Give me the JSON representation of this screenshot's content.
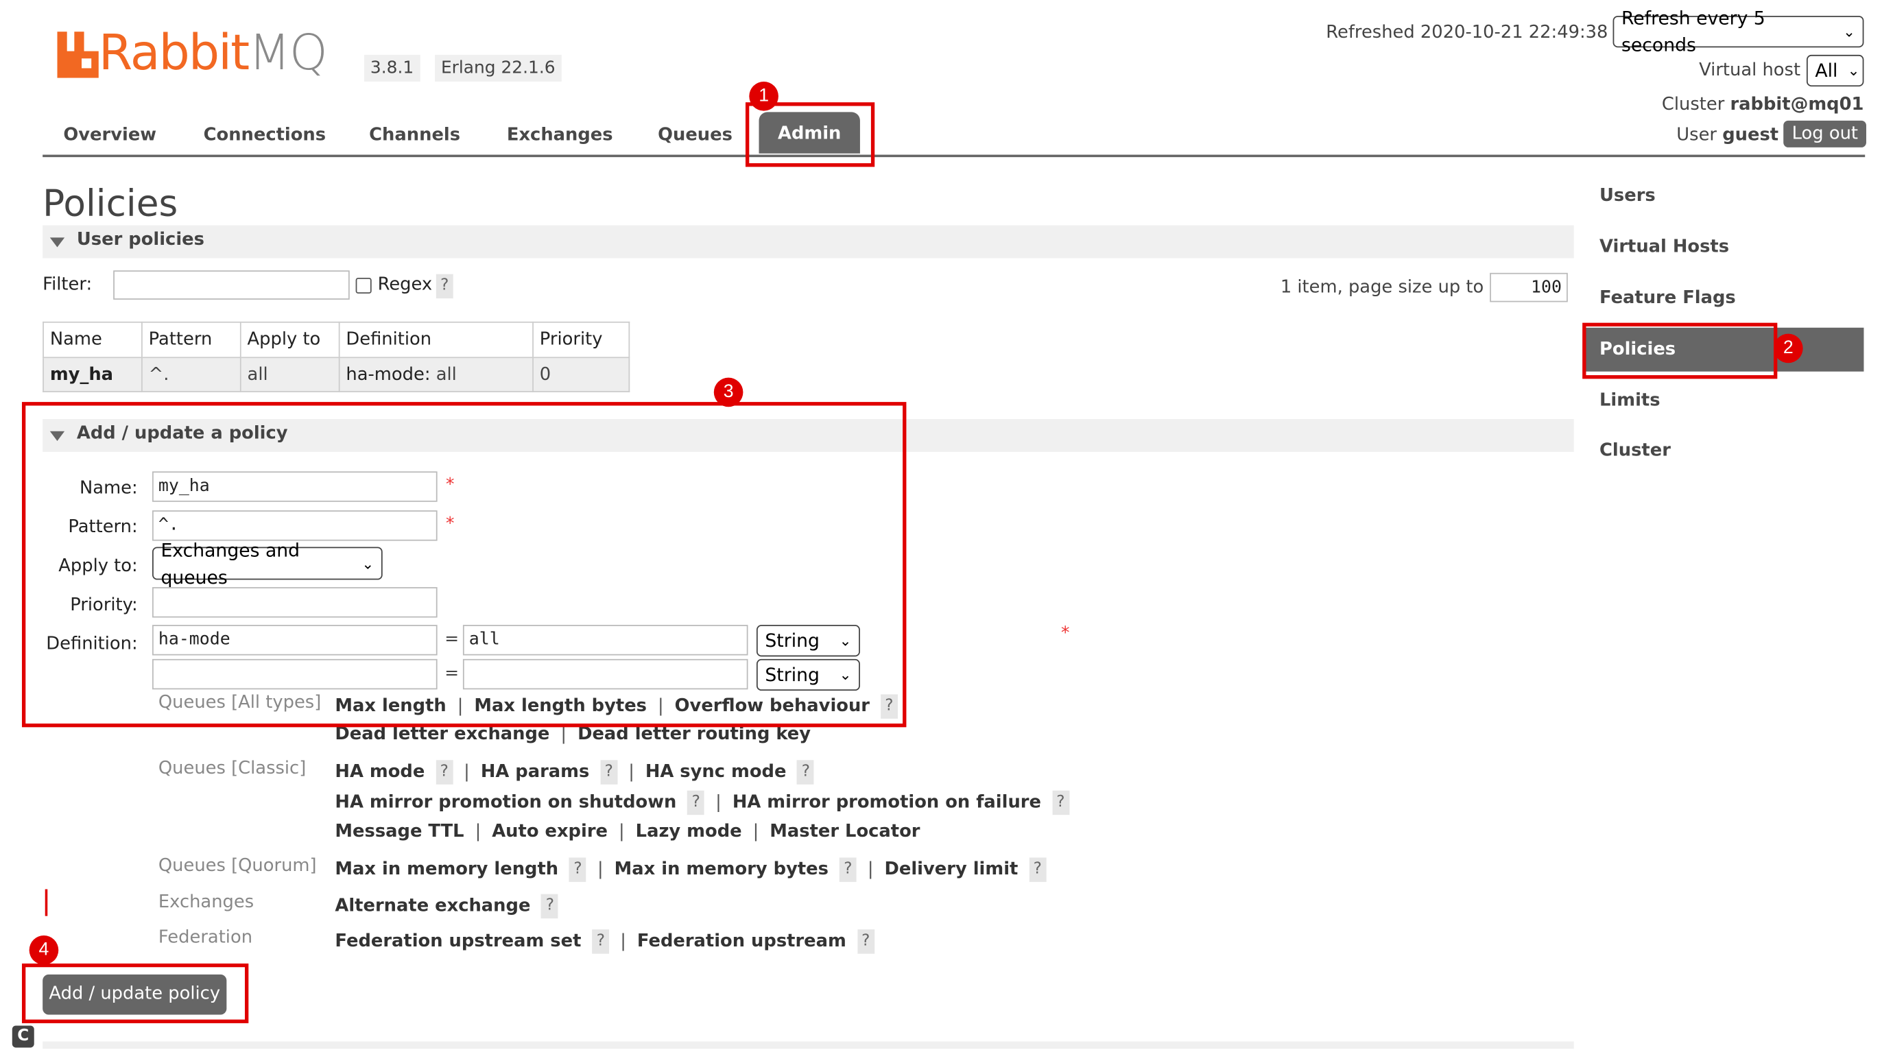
{
  "app": {
    "name_prefix": "Rabbit",
    "name_suffix": "MQ",
    "version": "3.8.1",
    "erlang": "Erlang 22.1.6",
    "brand_color": "#f26822"
  },
  "header": {
    "refreshed": "Refreshed 2020-10-21 22:49:38",
    "refresh_select": "Refresh every 5 seconds",
    "vhost_label": "Virtual host",
    "vhost_value": "All",
    "cluster_label": "Cluster",
    "cluster_value": "rabbit@mq01",
    "user_label": "User",
    "user_value": "guest",
    "logout": "Log out"
  },
  "nav": {
    "tabs": [
      "Overview",
      "Connections",
      "Channels",
      "Exchanges",
      "Queues",
      "Admin"
    ],
    "active": "Admin"
  },
  "sidebar": {
    "items": [
      "Users",
      "Virtual Hosts",
      "Feature Flags",
      "Policies",
      "Limits",
      "Cluster"
    ],
    "active": "Policies"
  },
  "annotations": [
    "1",
    "2",
    "3",
    "4"
  ],
  "page_title": "Policies",
  "user_policies": {
    "title": "User policies",
    "filter_label": "Filter:",
    "filter_value": "",
    "regex_label": "Regex",
    "help": "?",
    "paging_text": "1 item, page size up to",
    "page_size": "100",
    "columns": [
      "Name",
      "Pattern",
      "Apply to",
      "Definition",
      "Priority"
    ],
    "rows": [
      {
        "name": "my_ha",
        "pattern": "^.",
        "apply_to": "all",
        "def_key": "ha-mode:",
        "def_val": "all",
        "priority": "0"
      }
    ]
  },
  "form": {
    "title": "Add / update a policy",
    "name_label": "Name:",
    "name_value": "my_ha",
    "pattern_label": "Pattern:",
    "pattern_value": "^.",
    "apply_label": "Apply to:",
    "apply_value": "Exchanges and queues",
    "priority_label": "Priority:",
    "priority_value": "",
    "definition_label": "Definition:",
    "def1_key": "ha-mode",
    "def1_val": "all",
    "def1_type": "String",
    "def2_key": "",
    "def2_val": "",
    "def2_type": "String",
    "required": "*",
    "equals": "=",
    "groups": [
      {
        "label": "Queues [All types]",
        "lines": [
          [
            "Max length",
            "Max length bytes",
            "Overflow behaviour"
          ],
          [
            "Dead letter exchange",
            "Dead letter routing key"
          ]
        ]
      },
      {
        "label": "Queues [Classic]",
        "lines": [
          [
            "HA mode",
            "HA params",
            "HA sync mode"
          ],
          [
            "HA mirror promotion on shutdown",
            "HA mirror promotion on failure"
          ],
          [
            "Message TTL",
            "Auto expire",
            "Lazy mode",
            "Master Locator"
          ]
        ]
      },
      {
        "label": "Queues [Quorum]",
        "lines": [
          [
            "Max in memory length",
            "Max in memory bytes",
            "Delivery limit"
          ]
        ]
      },
      {
        "label": "Exchanges",
        "lines": [
          [
            "Alternate exchange"
          ]
        ]
      },
      {
        "label": "Federation",
        "lines": [
          [
            "Federation upstream set",
            "Federation upstream"
          ]
        ]
      }
    ],
    "submit": "Add / update policy"
  },
  "footer_icon": "C"
}
